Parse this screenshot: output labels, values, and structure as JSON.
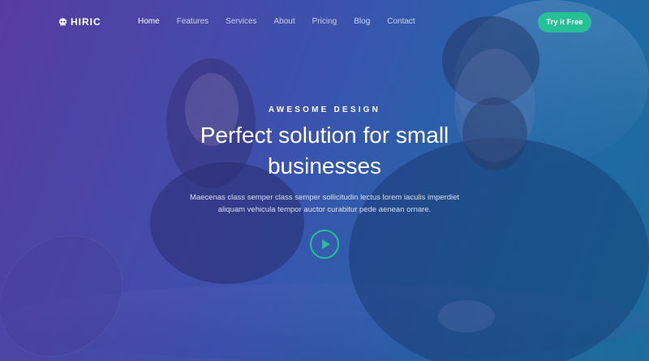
{
  "brand": {
    "name": "HIRIC",
    "logo_icon": "skull-icon"
  },
  "nav": {
    "items": [
      {
        "label": "Home",
        "active": true
      },
      {
        "label": "Features",
        "active": false
      },
      {
        "label": "Services",
        "active": false
      },
      {
        "label": "About",
        "active": false
      },
      {
        "label": "Pricing",
        "active": false
      },
      {
        "label": "Blog",
        "active": false
      },
      {
        "label": "Contact",
        "active": false
      }
    ],
    "cta_label": "Try it Free"
  },
  "hero": {
    "eyebrow": "AWESOME DESIGN",
    "headline_line1": "Perfect solution for small",
    "headline_line2": "businesses",
    "description_line1": "Maecenas class semper class semper sollicitudin lectus lorem iaculis imperdiet",
    "description_line2": "aliquam vehicula tempor auctor curabitur pede aenean ornare.",
    "play_icon": "play-icon"
  },
  "colors": {
    "accent": "#27bf95",
    "gradient_start": "#5a3fa5",
    "gradient_end": "#1d6a9a",
    "text": "#ffffff"
  }
}
